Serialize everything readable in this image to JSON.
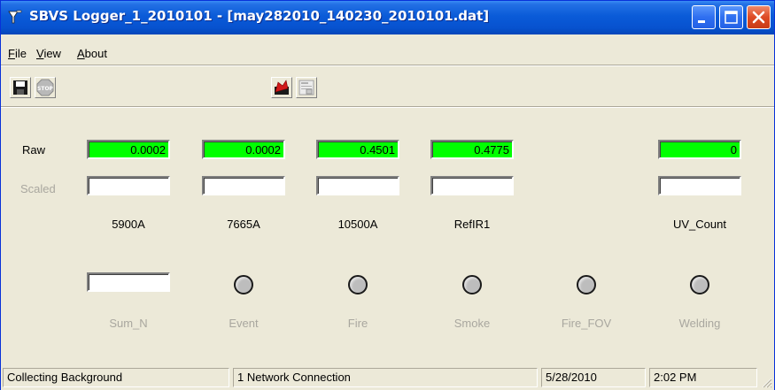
{
  "window": {
    "title": "SBVS Logger_1_2010101 - [may282010_140230_2010101.dat]"
  },
  "menu": {
    "file": "File",
    "view": "View",
    "about": "About"
  },
  "toolbar": {
    "icons": [
      "save-icon",
      "stop-icon",
      "chart-icon",
      "properties-icon"
    ]
  },
  "rows": {
    "raw_label": "Raw",
    "scaled_label": "Scaled"
  },
  "channels": [
    {
      "name": "5900A",
      "raw": "0.0002",
      "scaled": ""
    },
    {
      "name": "7665A",
      "raw": "0.0002",
      "scaled": ""
    },
    {
      "name": "10500A",
      "raw": "0.4501",
      "scaled": ""
    },
    {
      "name": "RefIR1",
      "raw": "0.4775",
      "scaled": ""
    },
    {
      "name": "UV_Count",
      "raw": "0",
      "scaled": ""
    }
  ],
  "sum_n": {
    "label": "Sum_N",
    "value": ""
  },
  "indicators": [
    {
      "label": "Event",
      "state": "off"
    },
    {
      "label": "Fire",
      "state": "off"
    },
    {
      "label": "Smoke",
      "state": "off"
    },
    {
      "label": "Fire_FOV",
      "state": "off"
    },
    {
      "label": "Welding",
      "state": "off"
    }
  ],
  "status": {
    "state": "Collecting Background",
    "network": "1 Network Connection",
    "date": "5/28/2010",
    "time": "2:02 PM"
  },
  "colors": {
    "raw_box": "#00ff00",
    "title_bar": "#0a5bd8",
    "disabled_text": "#a9a79f"
  }
}
